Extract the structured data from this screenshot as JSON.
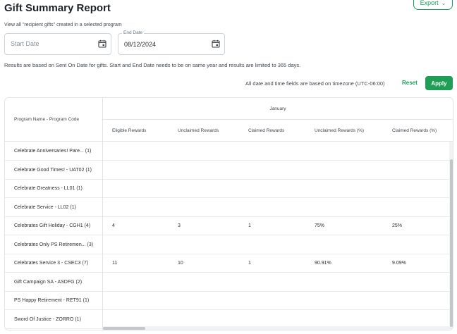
{
  "page": {
    "title": "Gift Summary Report",
    "subtitle": "View all \"recipient gifts\" created in a selected program"
  },
  "toolbar": {
    "export_label": "Export",
    "export_icon": "chevron-down-icon"
  },
  "filters": {
    "start_date": {
      "placeholder": "Start Date",
      "value": "",
      "icon": "calendar-icon"
    },
    "end_date": {
      "label": "End Date",
      "value": "08/12/2024",
      "icon": "calendar-icon"
    }
  },
  "info_text": "Results are based on Sent On Date for gifts. Start and End Date needs to be on same year and results are limited to 365 days.",
  "timezone_text": "All date and time fields are based on timezone (UTC-06:00)",
  "actions": {
    "reset_label": "Reset",
    "apply_label": "Apply"
  },
  "table": {
    "first_col_header": "Program Name - Program Code",
    "month": "January",
    "columns": [
      "Eligible Rewards",
      "Unclaimed Rewards",
      "Claimed Rewards",
      "Unclaimed Rewards (%)",
      "Claimed Rewards (%)"
    ],
    "rows": [
      {
        "name": "Celebrate Anniversaries! Pare...  (1)",
        "values": [
          "",
          "",
          "",
          "",
          ""
        ]
      },
      {
        "name": "Celebrate Good Times! - UAT02 (1)",
        "values": [
          "",
          "",
          "",
          "",
          ""
        ]
      },
      {
        "name": "Celebrate Greatness - LL01 (1)",
        "values": [
          "",
          "",
          "",
          "",
          ""
        ]
      },
      {
        "name": "Celebrate Service - LL02 (1)",
        "values": [
          "",
          "",
          "",
          "",
          ""
        ]
      },
      {
        "name": "Celebrates Gift Holiday - CGH1 (4)",
        "values": [
          "4",
          "3",
          "1",
          "75%",
          "25%"
        ]
      },
      {
        "name": "Celebrates Only PS Retiremen...  (3)",
        "values": [
          "",
          "",
          "",
          "",
          ""
        ]
      },
      {
        "name": "Celebrates Service 3 - CSEC3 (7)",
        "values": [
          "11",
          "10",
          "1",
          "90.91%",
          "9.09%"
        ]
      },
      {
        "name": "Gift Campaign SA - ASDFG (2)",
        "values": [
          "",
          "",
          "",
          "",
          ""
        ]
      },
      {
        "name": "PS Happy Retirement - RET91 (1)",
        "values": [
          "",
          "",
          "",
          "",
          ""
        ]
      },
      {
        "name": "Sword Of Justice - ZORRO (1)",
        "values": [
          "",
          "",
          "",
          "",
          ""
        ]
      }
    ]
  }
}
